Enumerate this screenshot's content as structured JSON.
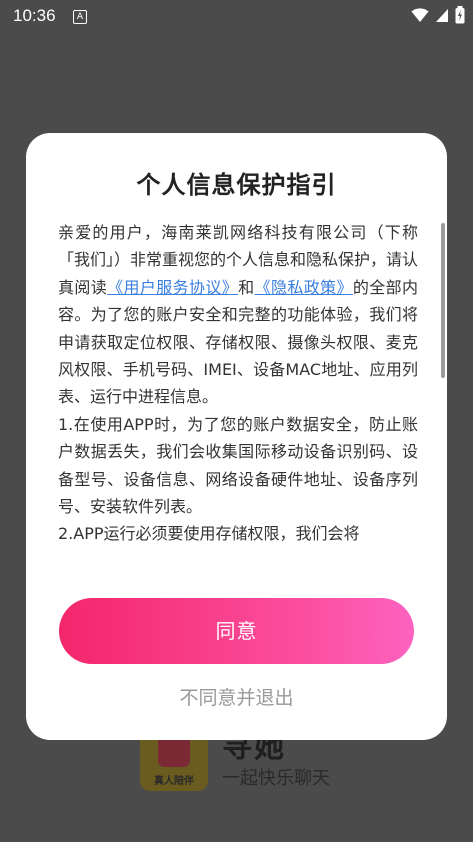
{
  "status_bar": {
    "time": "10:36",
    "notification_icon": "A"
  },
  "background_app": {
    "logo_text": "真人陪伴",
    "app_name": "寻她",
    "slogan": "一起快乐聊天"
  },
  "dialog": {
    "title": "个人信息保护指引",
    "paragraph1_part1": "亲爱的用户，海南莱凯网络科技有限公司（下称「我们」）非常重视您的个人信息和隐私保护，请认真阅读",
    "link_user_agreement": "《用户服务协议》",
    "and": "和",
    "link_privacy_policy": "《隐私政策》",
    "paragraph1_part2": "的全部内容。为了您的账户安全和完整的功能体验，我们将申请获取定位权限、存储权限、摄像头权限、麦克风权限、手机号码、IMEI、设备MAC地址、应用列表、运行中进程信息。",
    "paragraph2": "1.在使用APP时，为了您的账户数据安全，防止账户数据丢失，我们会收集国际移动设备识别码、设备型号、设备信息、网络设备硬件地址、设备序列号、安装软件列表。",
    "paragraph3": "2.APP运行必须要使用存储权限，我们会将",
    "agree_label": "同意",
    "disagree_label": "不同意并退出"
  },
  "colors": {
    "accent_start": "#f4266b",
    "accent_end": "#fd63c0",
    "link": "#3a7fe0"
  }
}
